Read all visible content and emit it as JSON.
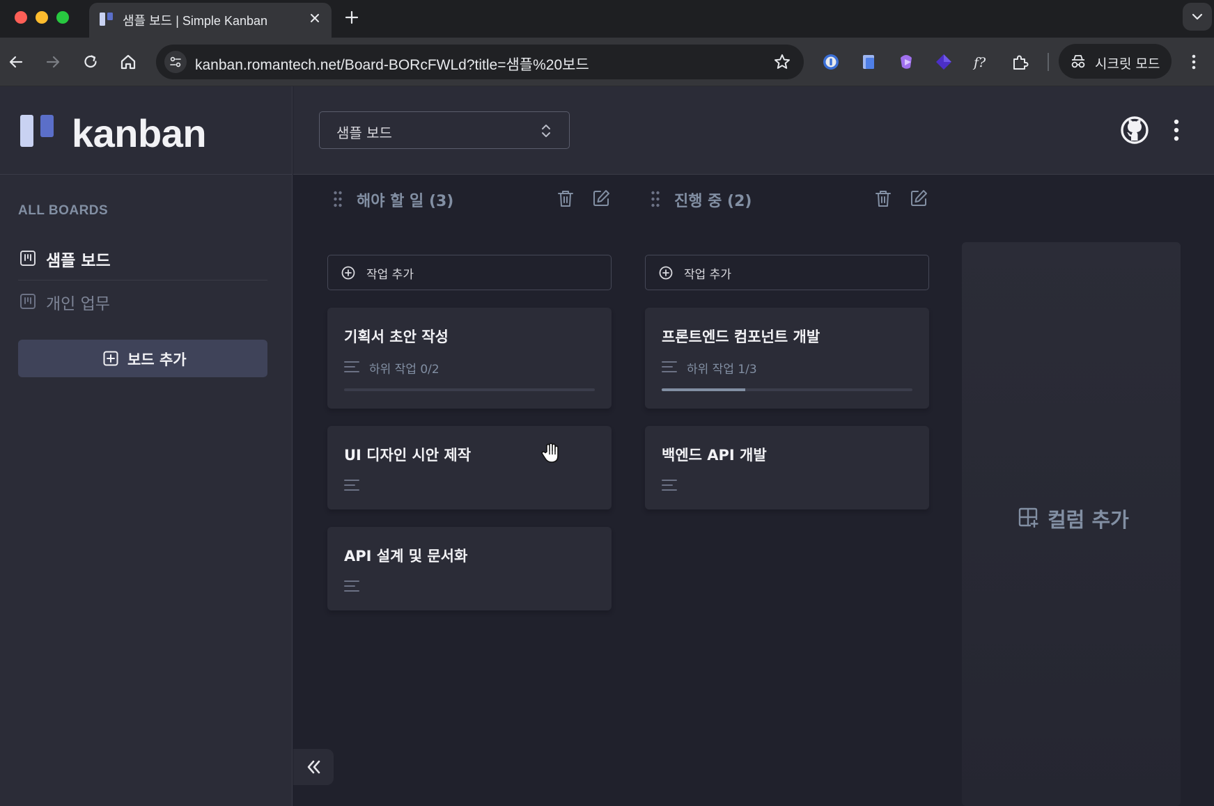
{
  "browser": {
    "tab_title": "샘플 보드 | Simple Kanban",
    "url": "kanban.romantech.net/Board-BORcFWLd?title=샘플%20보드",
    "incognito_label": "시크릿 모드",
    "extension_icons": [
      "password-manager-icon",
      "notes-extension-icon",
      "purple-extension-icon",
      "diamond-extension-icon",
      "formula-extension-icon",
      "puzzle-extensions-icon"
    ]
  },
  "app": {
    "logo_text": "kanban",
    "sidebar": {
      "section_title": "ALL BOARDS",
      "boards": [
        {
          "label": "샘플 보드",
          "active": true
        },
        {
          "label": "개인 업무",
          "active": false
        }
      ],
      "add_board_label": "보드 추가"
    },
    "header": {
      "selected_board": "샘플 보드"
    },
    "columns": [
      {
        "title": "해야 할 일 (3)",
        "add_task_label": "작업 추가",
        "cards": [
          {
            "title": "기획서 초안 작성",
            "subtasks": "하위 작업 0/2",
            "progress": 0.0
          },
          {
            "title": "UI 디자인 시안 제작"
          },
          {
            "title": "API 설계 및 문서화"
          }
        ]
      },
      {
        "title": "진행 중 (2)",
        "add_task_label": "작업 추가",
        "cards": [
          {
            "title": "프론트엔드 컴포넌트 개발",
            "subtasks": "하위 작업 1/3",
            "progress": 0.333
          },
          {
            "title": "백엔드 API 개발"
          }
        ]
      }
    ],
    "add_column_label": "컬럼 추가"
  },
  "colors": {
    "background": "#20212c",
    "panel": "#2b2c37",
    "muted_text": "#828fa3",
    "logo_accent": "#5b6fc9"
  }
}
